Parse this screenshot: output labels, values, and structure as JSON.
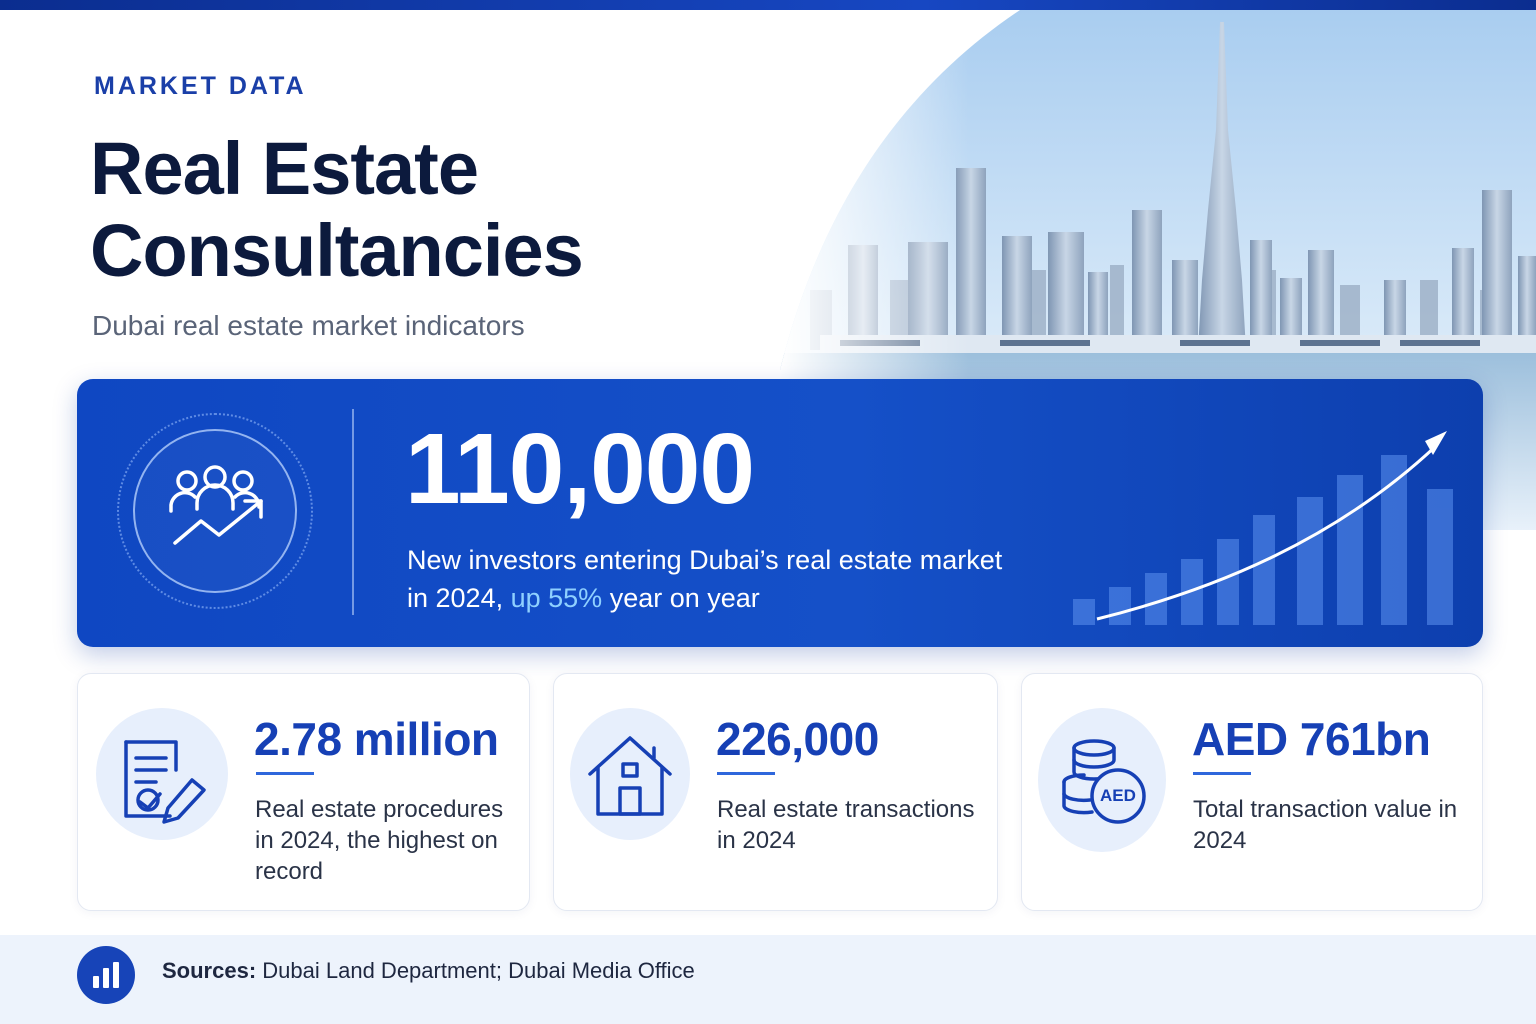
{
  "header": {
    "eyebrow": "MARKET DATA",
    "title_line1": "Real Estate",
    "title_line2": "Consultancies",
    "subtitle": "Dubai real estate market indicators"
  },
  "hero": {
    "icon": "investors-growth-icon",
    "value": "110,000",
    "desc_part1": "New investors entering Dubai’s real estate market in 2024,",
    "desc_highlight": "up 55%",
    "desc_part2": "year on year",
    "chart_icon": "rising-bars-arrow-icon"
  },
  "stats": [
    {
      "icon": "document-signature-icon",
      "value": "2.78 million",
      "desc": "Real estate procedures in 2024, the highest on record"
    },
    {
      "icon": "house-icon",
      "value": "226,000",
      "desc": "Real estate transactions in 2024"
    },
    {
      "icon": "aed-coins-icon",
      "value": "AED 761bn",
      "desc": "Total transaction value in 2024"
    }
  ],
  "footer": {
    "icon": "bar-chart-icon",
    "sources_label": "Sources:",
    "sources_text": "Dubai Land Department; Dubai Media Office"
  },
  "colors": {
    "brand_blue": "#1640b5",
    "hero_blue": "#1550c8",
    "navy_text": "#0c1a3d",
    "highlight": "#8fd0ff"
  }
}
